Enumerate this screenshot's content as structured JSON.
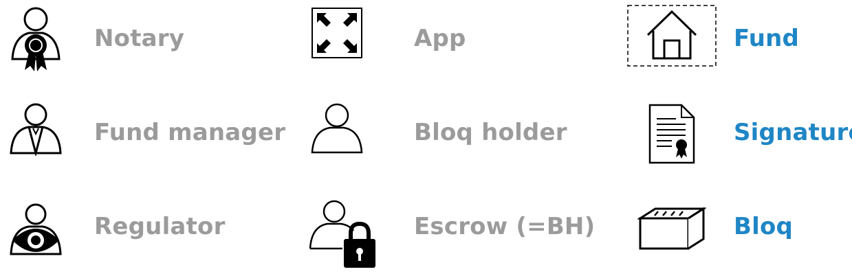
{
  "legend": {
    "actors": [
      {
        "label": "Notary",
        "icon": "notary-icon"
      },
      {
        "label": "Fund manager",
        "icon": "fund-manager-icon"
      },
      {
        "label": "Regulator",
        "icon": "regulator-icon"
      }
    ],
    "apps": [
      {
        "label": "App",
        "icon": "app-icon"
      },
      {
        "label": "Bloq holder",
        "icon": "bloq-holder-icon"
      },
      {
        "label": "Escrow (=BH)",
        "icon": "escrow-icon"
      }
    ],
    "objects": [
      {
        "label": "Fund",
        "icon": "home-icon"
      },
      {
        "label": "Signature",
        "icon": "certificate-icon"
      },
      {
        "label": "Bloq",
        "icon": "brick-icon"
      }
    ],
    "colors": {
      "actor_label": "#9b9b9b",
      "object_label": "#1f86c6"
    }
  }
}
